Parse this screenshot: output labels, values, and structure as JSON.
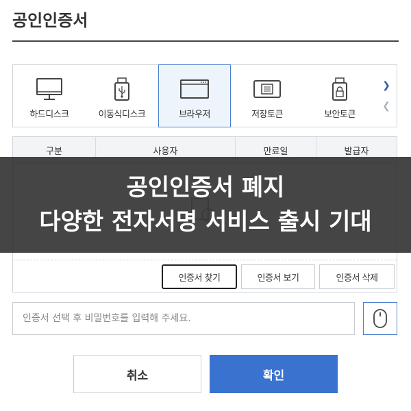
{
  "page": {
    "title": "공인인증서"
  },
  "storage": {
    "items": [
      {
        "label": "하드디스크",
        "icon": "monitor-icon"
      },
      {
        "label": "이동식디스크",
        "icon": "usb-drive-icon"
      },
      {
        "label": "브라우저",
        "icon": "browser-window-icon",
        "selected": true
      },
      {
        "label": "저장토큰",
        "icon": "token-chip-icon"
      },
      {
        "label": "보안토큰",
        "icon": "security-token-lock-icon"
      }
    ],
    "next_icon": "chevron-right-icon",
    "prev_icon": "chevron-left-icon"
  },
  "cert_table": {
    "columns": [
      "구분",
      "사용자",
      "만료일",
      "발급자"
    ],
    "buttons": {
      "find": "인증서 찾기",
      "view": "인증서 보기",
      "delete": "인증서 삭제"
    }
  },
  "password": {
    "placeholder": "인증서 선택 후 비밀번호를 입력해 주세요.",
    "mouse_icon": "mouse-icon"
  },
  "actions": {
    "cancel": "취소",
    "confirm": "확인"
  },
  "banner": {
    "line1": "공인인증서 폐지",
    "line2": "다양한 전자서명 서비스 출시 기대"
  },
  "colors": {
    "accent": "#3a72cf",
    "selected_bg": "#eef4fc",
    "banner_bg": "#262626"
  }
}
